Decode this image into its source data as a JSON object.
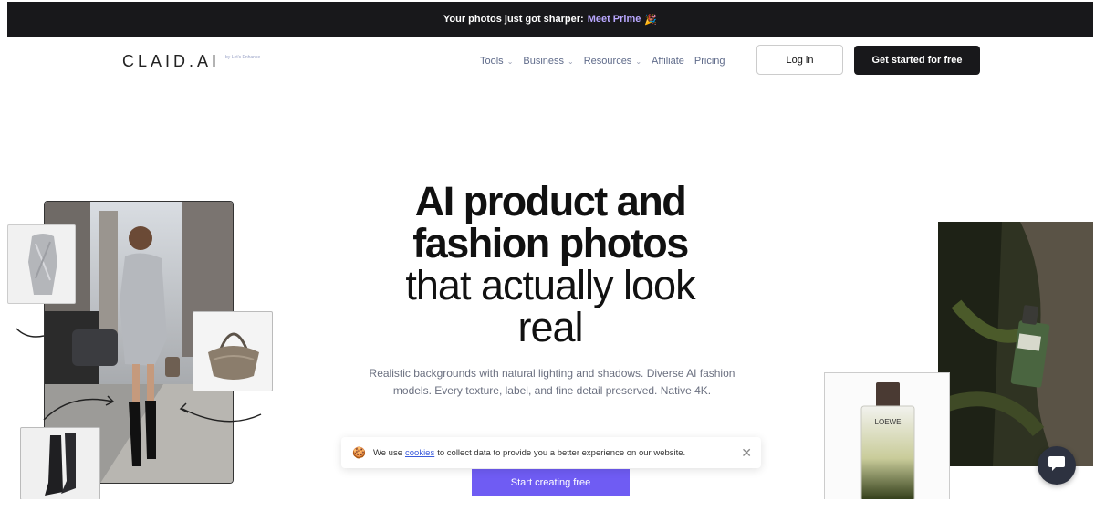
{
  "announcement": {
    "text": "Your photos just got sharper:",
    "link": "Meet Prime",
    "emoji": "🎉"
  },
  "logo": {
    "wordmark": "CLAID.AI",
    "byline": "by Let's Enhance"
  },
  "nav": {
    "items": [
      {
        "label": "Tools",
        "dropdown": true
      },
      {
        "label": "Business",
        "dropdown": true
      },
      {
        "label": "Resources",
        "dropdown": true
      },
      {
        "label": "Affiliate",
        "dropdown": false
      },
      {
        "label": "Pricing",
        "dropdown": false
      }
    ],
    "login_label": "Log in",
    "start_label": "Get started for free"
  },
  "hero": {
    "title_bold_1": "AI product and",
    "title_bold_2": "fashion photos",
    "title_light_1": "that actually look",
    "title_light_2": "real",
    "subtitle": "Realistic backgrounds with natural lighting and shadows. Diverse AI fashion models. Every texture, label, and fine detail preserved. Native 4K.",
    "cta_label": "Start creating free"
  },
  "cookie": {
    "emoji": "🍪",
    "text_before": "We use",
    "link": "cookies",
    "text_after": "to collect data to provide you a better experience on our website.",
    "close": "✕"
  },
  "images": {
    "perfume_brand": "LOEWE"
  },
  "colors": {
    "accent": "#6f5cf3",
    "dark": "#18181b",
    "link": "#b9a7ff"
  }
}
